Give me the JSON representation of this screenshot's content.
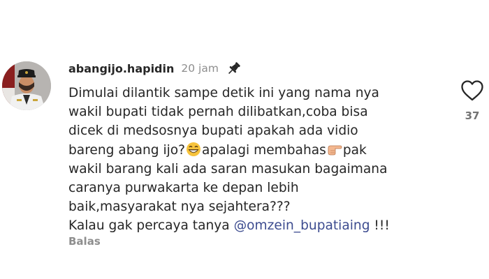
{
  "comment": {
    "username": "abangijo.hapidin",
    "timestamp": "20 jam",
    "pinned_icon": "pin-icon",
    "avatar_icon": "avatar",
    "text_lines": [
      "Dimulai dilantik sampe detik ini yang nama nya",
      "wakil bupati tidak pernah dilibatkan,coba bisa",
      "dicek di medsosnya bupati apakah ada vidio",
      "bareng abang ijo?",
      "apalagi membahas",
      "pak",
      "wakil barang kali ada saran masukan bagaimana",
      "caranya purwakarta ke depan lebih",
      "baik,masyarakat nya sejahtera???",
      "Kalau gak percaya tanya ",
      "@omzein_bupatiaing",
      " !!!"
    ],
    "emojis": [
      "grinning-face-emoji",
      "pointing-right-emoji"
    ],
    "reply_label": "Balas",
    "like_icon": "heart-icon",
    "like_count": "37"
  },
  "colors": {
    "text": "#262626",
    "muted": "#8e8e8e",
    "mention": "#3c4b8f",
    "background": "#ffffff"
  }
}
